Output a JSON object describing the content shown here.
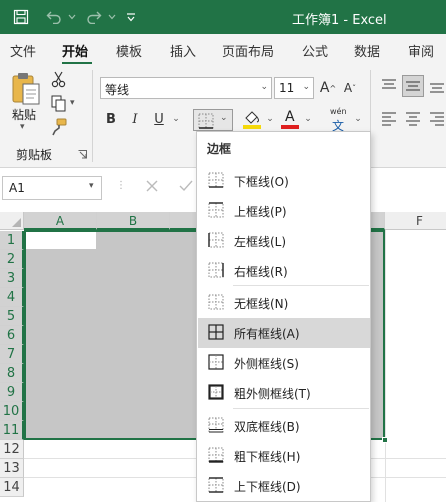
{
  "window": {
    "title": "工作簿1  -  Excel"
  },
  "ribbon_tabs": [
    "文件",
    "开始",
    "模板",
    "插入",
    "页面布局",
    "公式",
    "数据",
    "审阅"
  ],
  "clipboard": {
    "paste_label": "粘贴",
    "group_label": "剪贴板"
  },
  "font": {
    "name": "等线",
    "size": "11",
    "wen_label": "wén",
    "wen_char": "文"
  },
  "name_box": {
    "value": "A1"
  },
  "columns": [
    "A",
    "B",
    "F"
  ],
  "rows": [
    "1",
    "2",
    "3",
    "4",
    "5",
    "6",
    "7",
    "8",
    "9",
    "10",
    "11",
    "12",
    "13",
    "14"
  ],
  "border_menu": {
    "header": "边框",
    "items": [
      {
        "label": "下框线(O)",
        "icon": "bottom-border-icon"
      },
      {
        "label": "上框线(P)",
        "icon": "top-border-icon"
      },
      {
        "label": "左框线(L)",
        "icon": "left-border-icon"
      },
      {
        "label": "右框线(R)",
        "icon": "right-border-icon"
      },
      {
        "label": "无框线(N)",
        "icon": "no-border-icon"
      },
      {
        "label": "所有框线(A)",
        "icon": "all-borders-icon"
      },
      {
        "label": "外侧框线(S)",
        "icon": "outside-borders-icon"
      },
      {
        "label": "粗外侧框线(T)",
        "icon": "thick-outside-borders-icon"
      },
      {
        "label": "双底框线(B)",
        "icon": "double-bottom-border-icon"
      },
      {
        "label": "粗下框线(H)",
        "icon": "thick-bottom-border-icon"
      },
      {
        "label": "上下框线(D)",
        "icon": "top-bottom-border-icon"
      }
    ],
    "highlighted_index": 5
  },
  "colors": {
    "excel_green": "#217346",
    "selection_fill": "#c6c6c6",
    "font_color": "#e02020",
    "highlight_color": "#f5d90a"
  }
}
